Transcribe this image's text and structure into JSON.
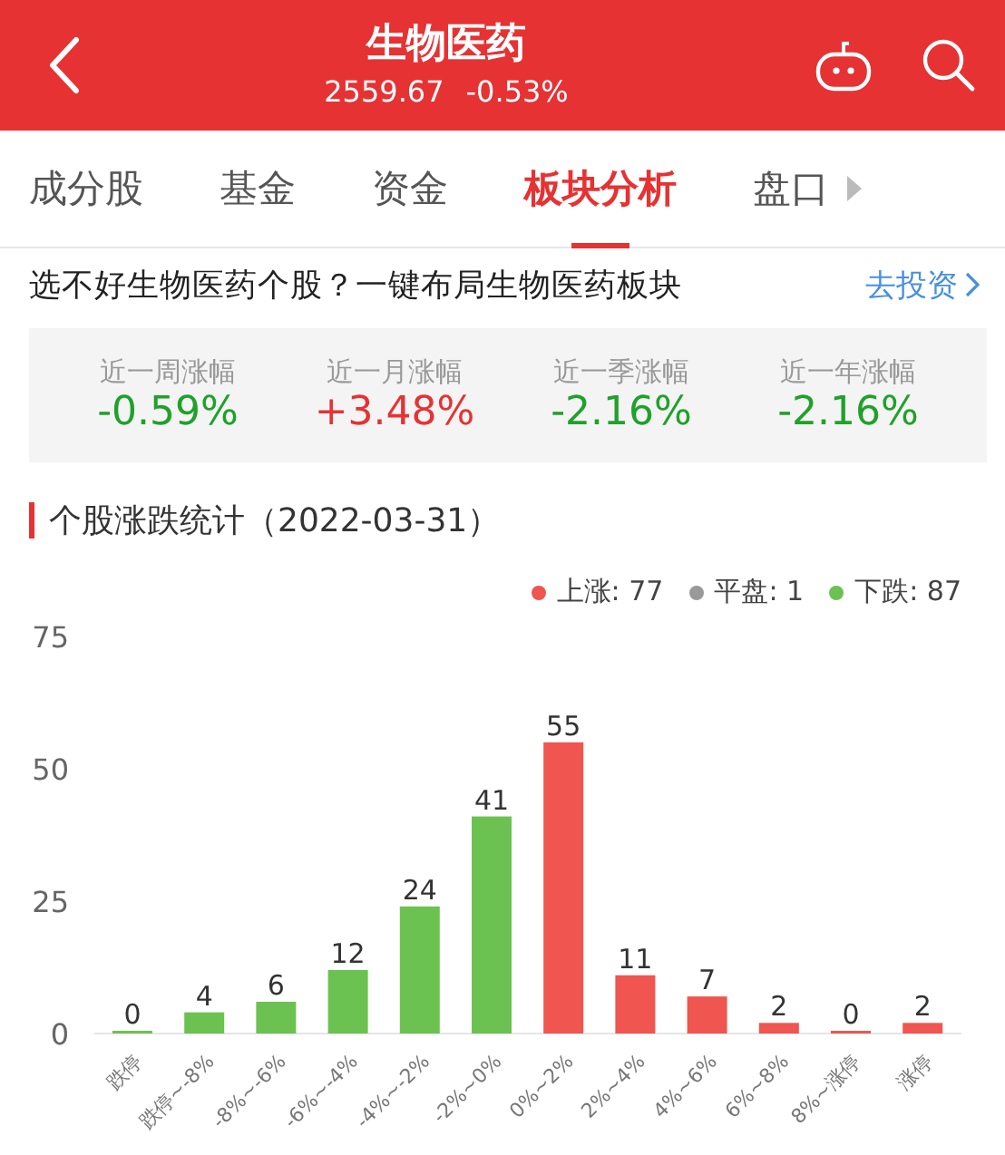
{
  "header": {
    "title": "生物医药",
    "index_value": "2559.67",
    "index_change": "-0.53%"
  },
  "tabs": [
    {
      "label": "成分股",
      "selected": false
    },
    {
      "label": "基金",
      "selected": false
    },
    {
      "label": "资金",
      "selected": false
    },
    {
      "label": "板块分析",
      "selected": true
    },
    {
      "label": "盘口",
      "selected": false
    }
  ],
  "promo": {
    "text": "选不好生物医药个股？一键布局生物医药板块",
    "link": "去投资"
  },
  "stats": [
    {
      "label": "近一周涨幅",
      "value": "-0.59%",
      "color": "#1fa12a"
    },
    {
      "label": "近一月涨幅",
      "value": "+3.48%",
      "color": "#e63233"
    },
    {
      "label": "近一季涨幅",
      "value": "-2.16%",
      "color": "#1fa12a"
    },
    {
      "label": "近一年涨幅",
      "value": "-2.16%",
      "color": "#1fa12a"
    }
  ],
  "section_title": "个股涨跌统计（2022-03-31）",
  "legend": [
    {
      "label": "上涨: 77",
      "color": "#f0554f"
    },
    {
      "label": "平盘: 1",
      "color": "#999999"
    },
    {
      "label": "下跌: 87",
      "color": "#6cc250"
    }
  ],
  "chart_data": {
    "type": "bar",
    "categories": [
      "跌停",
      "跌停~-8%",
      "-8%~-6%",
      "-6%~-4%",
      "-4%~-2%",
      "-2%~0%",
      "0%~2%",
      "2%~4%",
      "4%~6%",
      "6%~8%",
      "8%~涨停",
      "涨停"
    ],
    "series": [
      {
        "color": "#6cc250",
        "values": [
          0,
          4,
          6,
          12,
          24,
          41,
          null,
          null,
          null,
          null,
          null,
          null
        ]
      },
      {
        "color": "#f0554f",
        "values": [
          null,
          null,
          null,
          null,
          null,
          null,
          55,
          11,
          7,
          2,
          0,
          2
        ]
      }
    ],
    "ylim": [
      0,
      75
    ],
    "yticks": [
      0,
      25,
      50,
      75
    ],
    "data_labels": true
  }
}
